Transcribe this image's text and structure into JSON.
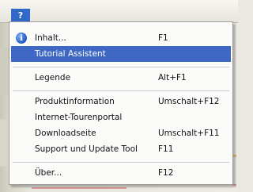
{
  "menubar": {
    "help_title": "?"
  },
  "menu": {
    "items": [
      {
        "label": "Inhalt...",
        "shortcut": "F1",
        "icon": "info-icon"
      },
      {
        "label": "Tutorial Assistent",
        "shortcut": "",
        "highlighted": true
      },
      {
        "label": "Legende",
        "shortcut": "Alt+F1"
      },
      {
        "label": "Produktinformation",
        "shortcut": "Umschalt+F12"
      },
      {
        "label": "Internet-Tourenportal",
        "shortcut": ""
      },
      {
        "label": "Downloadseite",
        "shortcut": "Umschalt+F11"
      },
      {
        "label": "Support und Update Tool",
        "shortcut": "F11"
      },
      {
        "label": "Über...",
        "shortcut": "F12"
      }
    ]
  },
  "colors": {
    "highlight": "#3f68c4",
    "menu_bg": "#fbfbfa"
  }
}
